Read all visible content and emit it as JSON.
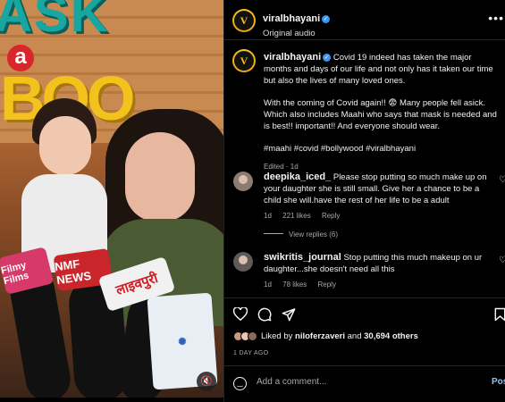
{
  "post": {
    "username": "viralbhayani",
    "audio": "Original audio",
    "caption": {
      "username": "viralbhayani",
      "paragraph1": "Covid 19 indeed has taken the major months and days of our life and not only has it taken our time but also the lives of many loved ones.",
      "paragraph2": "With the coming of Covid again!! 😨 Many people fell asick. Which also includes Maahi who says that mask is needed and is best!! important!! And everyone should wear.",
      "hashtags": "#maahi #covid #bollywood #viralbhayani",
      "meta": "Edited · 1d"
    },
    "comments": [
      {
        "username": "deepika_iced_",
        "text": "Please stop putting so much make up on your daughter she is still small. Give her a chance to be a child she will.have the rest of her life to be a adult",
        "age": "1d",
        "likes": "221 likes",
        "reply": "Reply",
        "view_replies": "View replies (6)"
      },
      {
        "username": "swikritis_journal",
        "text": "Stop putting this much makeup on ur daughter...she doesn't need all this",
        "age": "1d",
        "likes": "78 likes",
        "reply": "Reply"
      }
    ],
    "likes": {
      "prefix": "Liked by",
      "user": "niloferzaveri",
      "connector": "and",
      "count": "30,694 others"
    },
    "date": "1 DAY AGO",
    "add_comment": {
      "placeholder": "Add a comment...",
      "post_label": "Post"
    }
  },
  "media": {
    "sign_top": "ASK",
    "sign_a": "a",
    "sign_boo": "BOO",
    "mic_labels": [
      "Filmy Films",
      "NMF NEWS",
      "लाइवपुरी"
    ]
  },
  "icons": {
    "more": "more-options-icon",
    "heart": "heart-icon",
    "comment": "comment-icon",
    "share": "share-icon",
    "save": "bookmark-icon",
    "emoji": "emoji-icon",
    "volume": "mute-icon"
  },
  "colors": {
    "accent": "#3897f0",
    "link": "#8fc3f7",
    "muted": "#a8a8a8"
  }
}
